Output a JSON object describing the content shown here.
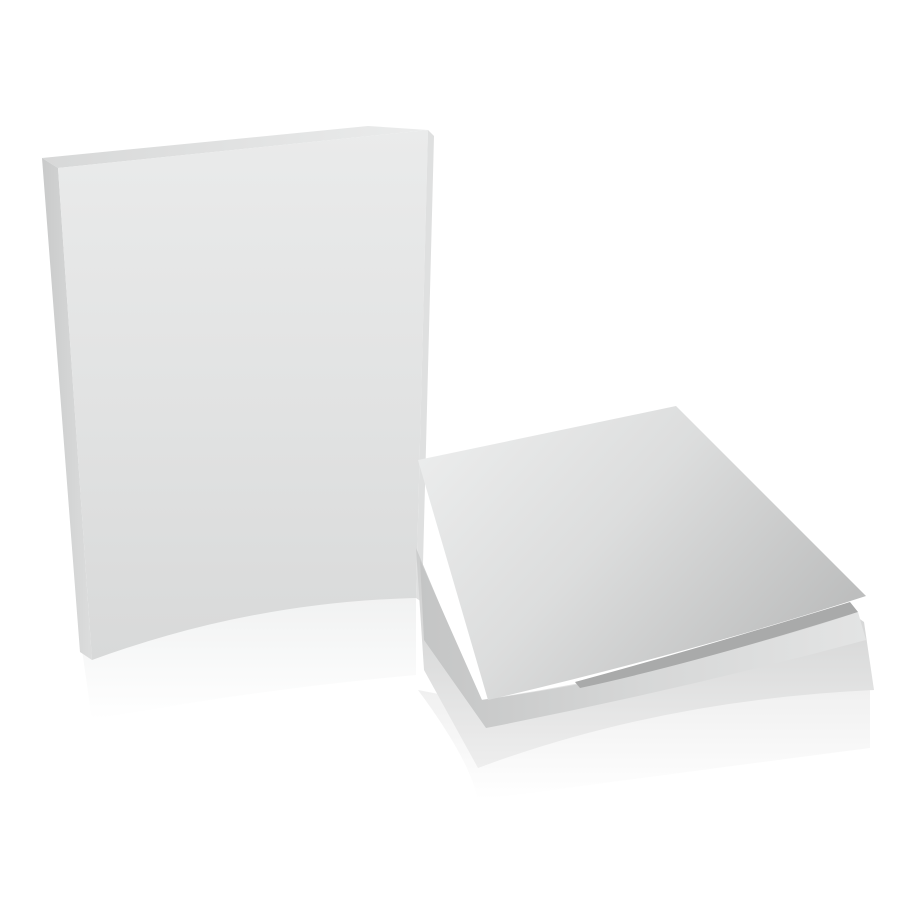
{
  "scene": {
    "background_color": "#ffffff",
    "objects": [
      {
        "name": "standing-book-mockup",
        "description_color": "#e8e9e9",
        "cover_blank": true
      },
      {
        "name": "lying-magazine-mockup",
        "description_color": "#d9dada",
        "cover_blank": true
      }
    ]
  }
}
